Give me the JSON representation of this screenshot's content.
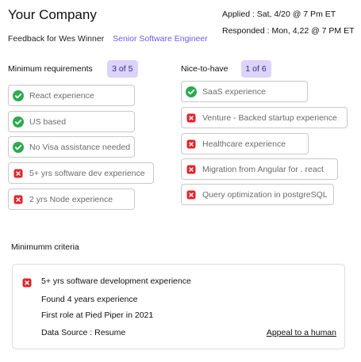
{
  "header": {
    "company": "Your Company",
    "applied": "Applied : Sat, 4/20 @ 7 Pm ET",
    "responded": "Responded : Mon, 4,22 @ 7 PM ET",
    "feedback_for": "Feedback for Wes Winner",
    "role": "Senior Software Engineer"
  },
  "colors": {
    "accent": "#6c5ce7",
    "badge_bg": "#dcd3fb",
    "check_green": "#2eaa4f",
    "cross_red": "#e0262b"
  },
  "minimum": {
    "title": "Minimum requirements",
    "badge": "3 of 5",
    "items": [
      {
        "label": "React experience",
        "status": "check-icon"
      },
      {
        "label": "US based",
        "status": "check-icon"
      },
      {
        "label": "No Visa assistance needed",
        "status": "check-icon"
      },
      {
        "label": "5+ yrs software dev experience",
        "status": "cross-icon"
      },
      {
        "label": "2 yrs Node experience",
        "status": "cross-icon"
      }
    ]
  },
  "nice": {
    "title": "Nice-to-have",
    "badge": "1 of 6",
    "items": [
      {
        "label": "SaaS experience",
        "status": "check-icon"
      },
      {
        "label": "Venture - Backed startup experience",
        "status": "cross-icon"
      },
      {
        "label": "Healthcare experience",
        "status": "cross-icon"
      },
      {
        "label": "Migration from Angular for . react",
        "status": "cross-icon"
      },
      {
        "label": "Query optimization in postgreSQL",
        "status": "cross-icon"
      }
    ]
  },
  "criteria": {
    "title": "Minimumm criteria",
    "heading": "5+ yrs software development experience",
    "found": "Found 4 years experience",
    "first_role": "First role at Pied Piper in 2021",
    "source": "Data Source : Resume",
    "appeal": "Appeal to a human"
  }
}
